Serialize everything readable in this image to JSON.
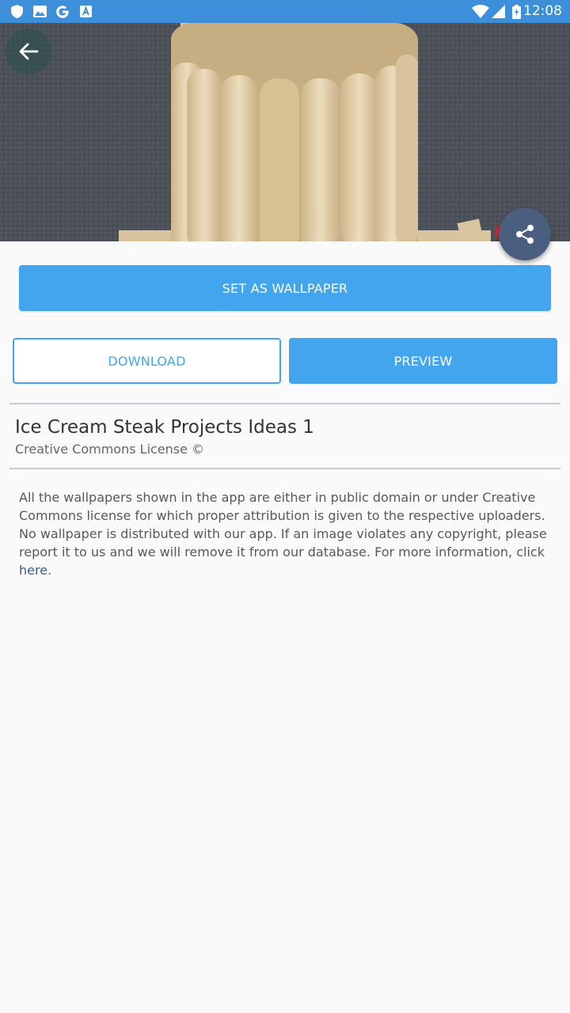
{
  "status_bar": {
    "time": "12:08",
    "left_icons": [
      "shield-icon",
      "image-icon",
      "google-icon",
      "text-icon"
    ],
    "right_icons": [
      "wifi-icon",
      "signal-icon",
      "battery-charging-icon"
    ]
  },
  "hero": {
    "description": "popsicle stick pencil holder photo"
  },
  "actions": {
    "set_wallpaper": "SET AS WALLPAPER",
    "download": "DOWNLOAD",
    "preview": "PREVIEW"
  },
  "info": {
    "title": "Ice Cream Steak Projects Ideas 1",
    "license": "Creative Commons License ©"
  },
  "disclaimer": {
    "text": "All the wallpapers shown in the app are either in public domain or under Creative Commons license for which proper attribution is given to the respective uploaders. No wallpaper is distributed with our app. If an image violates any copyright, please report it to us and we will remove it from our database. For more information, click ",
    "link_text": "here",
    "tail": "."
  },
  "colors": {
    "status_bar": "#3d8fd9",
    "accent": "#44a5ef",
    "share_fab": "#4a5f7f",
    "link": "#3a5d8f"
  }
}
